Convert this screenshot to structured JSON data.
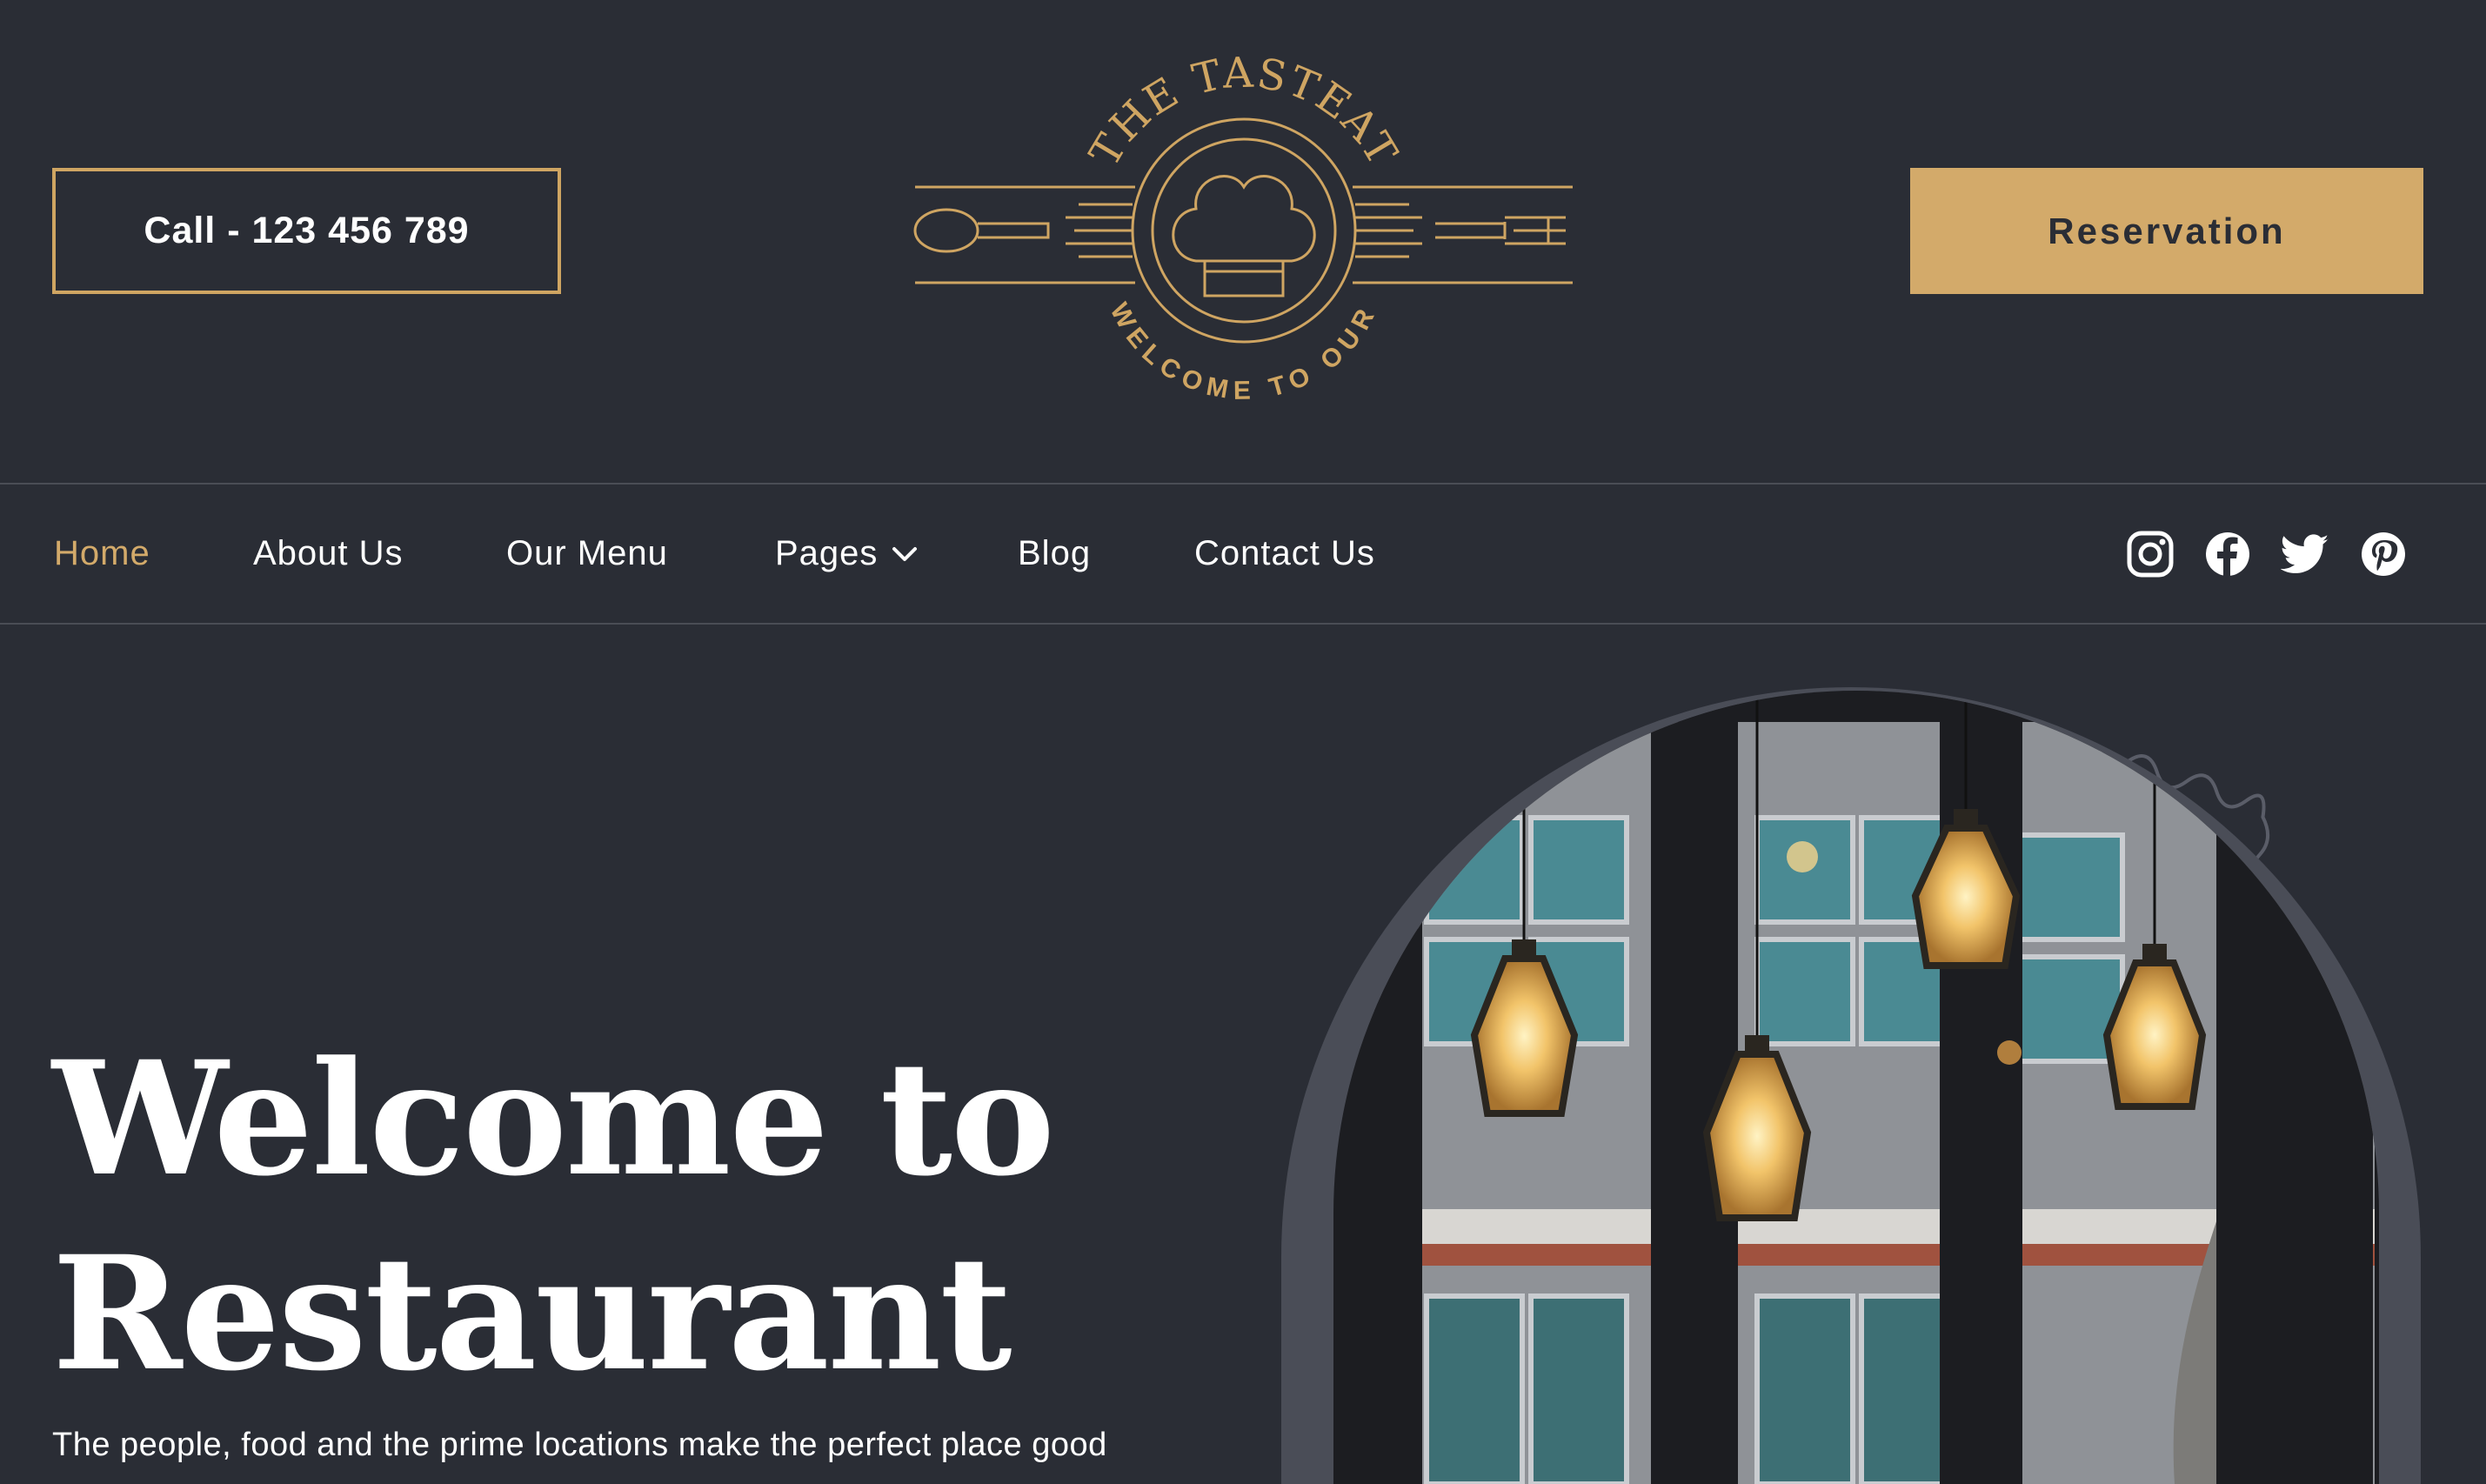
{
  "header": {
    "call_label": "Call - 123 456 789",
    "reservation_label": "Reservation",
    "logo": {
      "top_text": "THE TASTEAT",
      "bottom_text": "WELCOME TO OUR"
    }
  },
  "nav": {
    "items": [
      {
        "label": "Home",
        "active": true
      },
      {
        "label": "About Us",
        "active": false
      },
      {
        "label": "Our Menu",
        "active": false
      },
      {
        "label": "Pages",
        "active": false,
        "dropdown": true
      },
      {
        "label": "Blog",
        "active": false
      },
      {
        "label": "Contact Us",
        "active": false
      }
    ],
    "social": [
      "instagram-icon",
      "facebook-icon",
      "twitter-icon",
      "pinterest-icon"
    ]
  },
  "hero": {
    "title_line1": "Welcome to",
    "title_line2": "Restaurant",
    "subtitle": "The people, food and the prime locations make the perfect place good"
  },
  "colors": {
    "background": "#2a2d35",
    "accent": "#d3aa6a",
    "text": "#ffffff",
    "divider": "#4a4d55"
  }
}
